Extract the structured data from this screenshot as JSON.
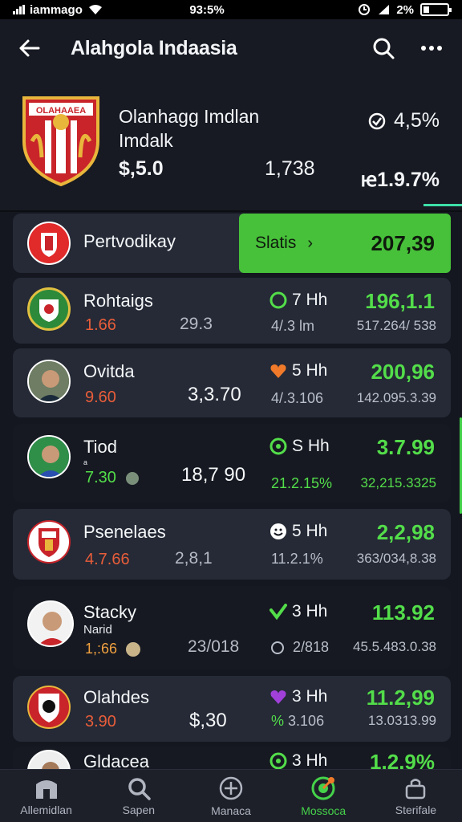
{
  "status_bar": {
    "carrier": "iammago",
    "time": "93:5%",
    "battery": "2%"
  },
  "header": {
    "title": "Alahgola Indaasia",
    "team": {
      "name_line1": "Olanhagg Imdlan",
      "name_line2": "Imdalk",
      "price": "$,5.0",
      "volume": "1,738",
      "percent": "ꭡ1.9.7%",
      "change": "4,5%"
    }
  },
  "list": {
    "highlight_row": {
      "name": "Pertvodikay",
      "button_label": "Slatis",
      "button_value": "207,39"
    },
    "rows": [
      {
        "name": "Rohtaigs",
        "sub": "",
        "small": "1.66",
        "mid": "29.3",
        "time": "7 Hh",
        "pct": "4/.3 lm",
        "price": "196,1.1",
        "vol": "517.264/ 538"
      },
      {
        "name": "Ovitda",
        "sub": "",
        "small": "9.60",
        "mid": "3,3.70",
        "time": "5 Hh",
        "pct": "4/.3.106",
        "price": "200,96",
        "vol": "142.095.3.39"
      },
      {
        "name": "Tiod",
        "sub": "ᵃ",
        "small": "7.30",
        "mid": "18,7 90",
        "time": "S Hh",
        "pct": "21.2.15%",
        "price": "3.7.99",
        "vol": "32,215.3325"
      },
      {
        "name": "Psenelaes",
        "sub": "",
        "small": "4.7.66",
        "mid": "2,8,1",
        "time": "5 Hh",
        "pct": "11.2.1%",
        "price": "2,2,98",
        "vol": "363/034,8.38"
      },
      {
        "name": "Stacky",
        "sub": "Narid",
        "small": "1,:66",
        "mid": "23/018",
        "time": "3 Hh",
        "pct": "2/818",
        "price": "113.92",
        "vol": "45.5.483.0.38"
      },
      {
        "name": "Olahdes",
        "sub": "",
        "small": "3.90",
        "mid": "$,30",
        "time": "3 Hh",
        "pct": "3.106",
        "price": "11.2,99",
        "vol": "13.0313.99"
      },
      {
        "name": "Gldacea",
        "sub": "",
        "small": "",
        "mid": "",
        "time": "3 Hh",
        "pct": "",
        "price": "1.2.9%",
        "vol": ""
      }
    ]
  },
  "tabbar": {
    "tabs": [
      {
        "label": "Allemidlan",
        "icon": "stadium-icon"
      },
      {
        "label": "Sapen",
        "icon": "search-icon"
      },
      {
        "label": "Manaca",
        "icon": "crosshair-icon"
      },
      {
        "label": "Mossoca",
        "icon": "target-icon",
        "active": true
      },
      {
        "label": "Sterifale",
        "icon": "bag-icon"
      }
    ]
  },
  "colors": {
    "background": "#14171f",
    "card": "#252a36",
    "accent_green": "#53dd4a",
    "highlight": "#47c13a",
    "negative": "#e85d3a"
  }
}
